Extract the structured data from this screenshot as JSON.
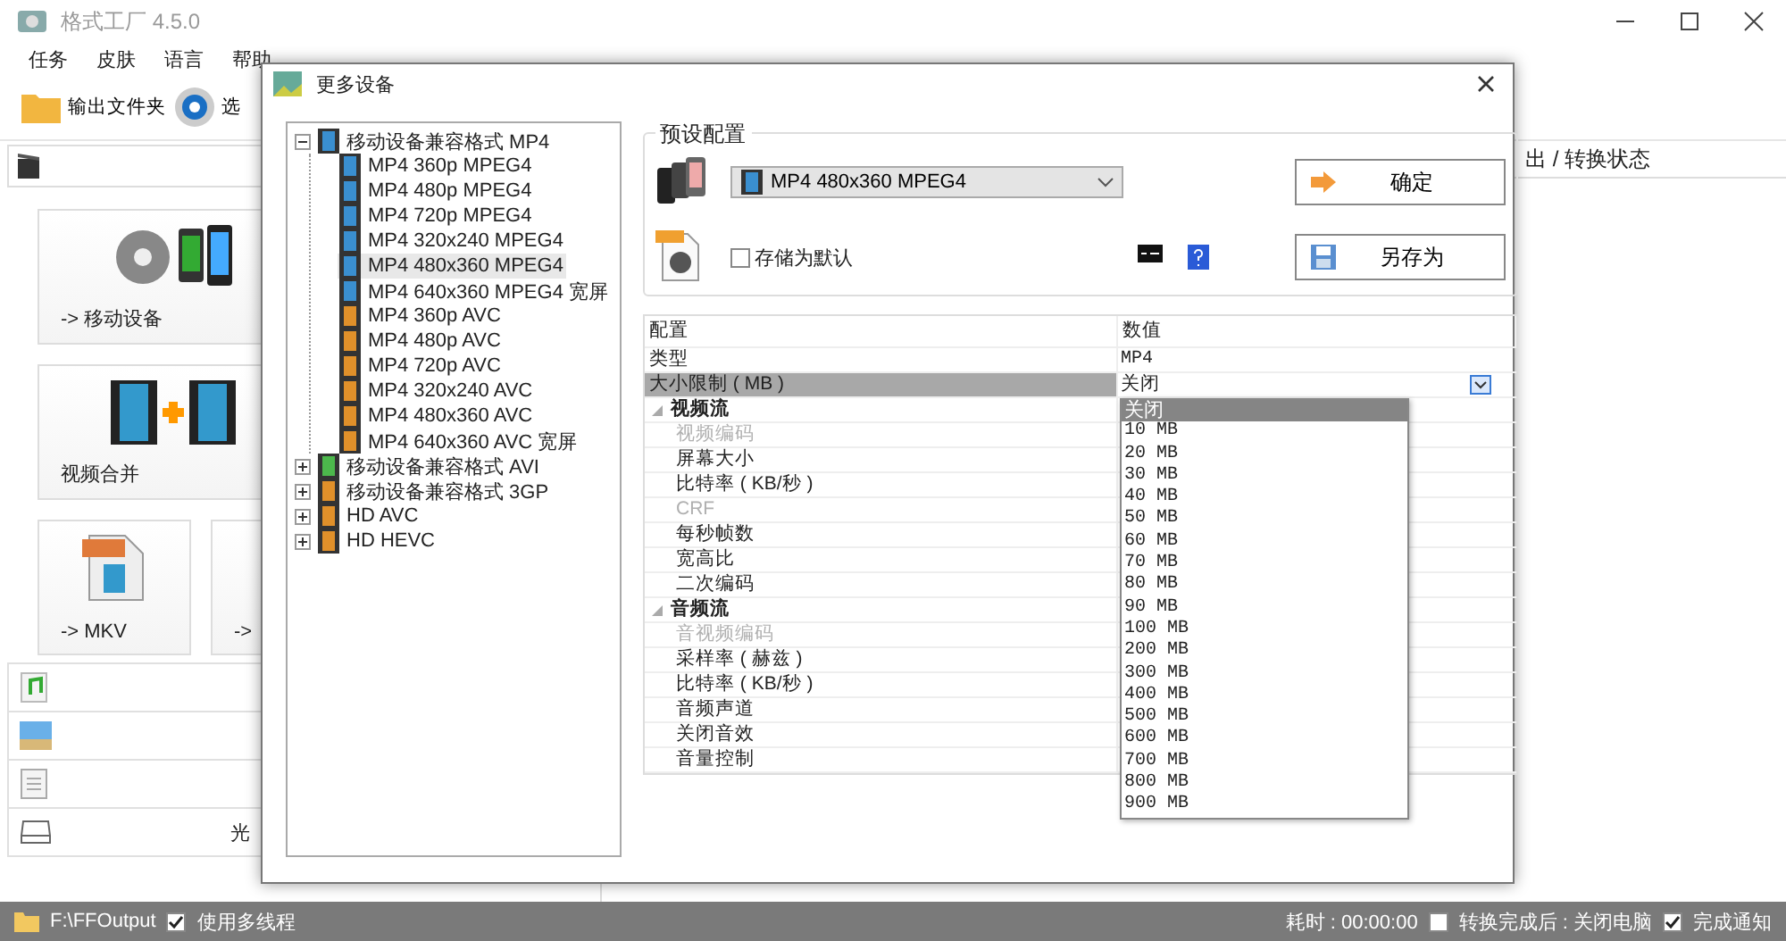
{
  "window": {
    "title": "格式工厂 4.5.0"
  },
  "menu": [
    "任务",
    "皮肤",
    "语言",
    "帮助"
  ],
  "toolbar": [
    {
      "label": "输出文件夹",
      "kind": "folder"
    },
    {
      "label": "选",
      "kind": "options"
    }
  ],
  "tiles": [
    {
      "label": "-> 移动设备",
      "kind": "devices"
    },
    {
      "label": "视频合并",
      "kind": "join"
    },
    {
      "label": "-> MKV",
      "kind": "mkv"
    },
    {
      "label": "->",
      "kind": "other"
    }
  ],
  "categories": [
    {
      "kind": "audio"
    },
    {
      "kind": "picture"
    },
    {
      "kind": "document"
    },
    {
      "kind": "disc",
      "label": "光"
    }
  ],
  "task_header": "出 / 转换状态",
  "dialog": {
    "title": "更多设备",
    "tree": [
      {
        "label": "移动设备兼容格式 MP4",
        "kind": "mp4",
        "expanded": true,
        "children": [
          {
            "label": "MP4 360p MPEG4",
            "kind": "mpeg4",
            "selected": false
          },
          {
            "label": "MP4 480p MPEG4",
            "kind": "mpeg4",
            "selected": false
          },
          {
            "label": "MP4 720p MPEG4",
            "kind": "mpeg4",
            "selected": false
          },
          {
            "label": "MP4 320x240 MPEG4",
            "kind": "mpeg4",
            "selected": false
          },
          {
            "label": "MP4 480x360 MPEG4",
            "kind": "mpeg4",
            "selected": true
          },
          {
            "label": "MP4 640x360 MPEG4 宽屏",
            "kind": "mpeg4",
            "selected": false
          },
          {
            "label": "MP4 360p AVC",
            "kind": "avc",
            "selected": false
          },
          {
            "label": "MP4 480p AVC",
            "kind": "avc",
            "selected": false
          },
          {
            "label": "MP4 720p AVC",
            "kind": "avc",
            "selected": false
          },
          {
            "label": "MP4 320x240 AVC",
            "kind": "avc",
            "selected": false
          },
          {
            "label": "MP4 480x360 AVC",
            "kind": "avc",
            "selected": false
          },
          {
            "label": "MP4 640x360 AVC 宽屏",
            "kind": "avc",
            "selected": false
          }
        ]
      },
      {
        "label": "移动设备兼容格式 AVI",
        "kind": "avi",
        "expanded": false
      },
      {
        "label": "移动设备兼容格式 3GP",
        "kind": "threegp",
        "expanded": false
      },
      {
        "label": "HD AVC",
        "kind": "hd",
        "expanded": false
      },
      {
        "label": "HD HEVC",
        "kind": "hd",
        "expanded": false
      }
    ],
    "preset": {
      "title": "预设配置",
      "value": "MP4 480x360 MPEG4",
      "ok": "确定",
      "save_default": {
        "label": "存储为默认",
        "checked": false
      },
      "save_as": "另存为"
    },
    "grid": {
      "columns": [
        "配置",
        "数值"
      ],
      "rows": [
        {
          "kind": "row",
          "label": "类型",
          "value": "MP4",
          "selected": false,
          "disabled": false
        },
        {
          "kind": "row",
          "label": "大小限制 ( MB )",
          "value": "关闭",
          "selected": true,
          "disabled": false
        },
        {
          "kind": "section",
          "label": "视频流",
          "expanded": true
        },
        {
          "kind": "row",
          "label": "视频编码",
          "selected": false,
          "disabled": true
        },
        {
          "kind": "row",
          "label": "屏幕大小",
          "selected": false,
          "disabled": false
        },
        {
          "kind": "row",
          "label": "比特率 ( KB/秒 )",
          "selected": false,
          "disabled": false
        },
        {
          "kind": "row",
          "label": "CRF",
          "selected": false,
          "disabled": true
        },
        {
          "kind": "row",
          "label": "每秒帧数",
          "selected": false,
          "disabled": false
        },
        {
          "kind": "row",
          "label": "宽高比",
          "selected": false,
          "disabled": false
        },
        {
          "kind": "row",
          "label": "二次编码",
          "selected": false,
          "disabled": false
        },
        {
          "kind": "section",
          "label": "音频流",
          "expanded": true
        },
        {
          "kind": "row",
          "label": "音视频编码",
          "selected": false,
          "disabled": true
        },
        {
          "kind": "row",
          "label": "采样率 ( 赫兹 )",
          "selected": false,
          "disabled": false
        },
        {
          "kind": "row",
          "label": "比特率 ( KB/秒 )",
          "selected": false,
          "disabled": false
        },
        {
          "kind": "row",
          "label": "音频声道",
          "selected": false,
          "disabled": false
        },
        {
          "kind": "row",
          "label": "关闭音效",
          "selected": false,
          "disabled": false
        },
        {
          "kind": "row",
          "label": "音量控制",
          "selected": false,
          "disabled": false
        }
      ],
      "options": [
        {
          "label": "关闭",
          "selected": true
        },
        {
          "label": "10 MB",
          "selected": false
        },
        {
          "label": "20 MB",
          "selected": false
        },
        {
          "label": "30 MB",
          "selected": false
        },
        {
          "label": "40 MB",
          "selected": false
        },
        {
          "label": "50 MB",
          "selected": false
        },
        {
          "label": "60 MB",
          "selected": false
        },
        {
          "label": "70 MB",
          "selected": false
        },
        {
          "label": "80 MB",
          "selected": false
        },
        {
          "label": "90 MB",
          "selected": false
        },
        {
          "label": "100 MB",
          "selected": false
        },
        {
          "label": "200 MB",
          "selected": false
        },
        {
          "label": "300 MB",
          "selected": false
        },
        {
          "label": "400 MB",
          "selected": false
        },
        {
          "label": "500 MB",
          "selected": false
        },
        {
          "label": "600 MB",
          "selected": false
        },
        {
          "label": "700 MB",
          "selected": false
        },
        {
          "label": "800 MB",
          "selected": false
        },
        {
          "label": "900 MB",
          "selected": false
        }
      ]
    }
  },
  "status_bar": {
    "output_folder": "F:\\FFOutput",
    "multithread": {
      "label": "使用多线程",
      "checked": true
    },
    "elapsed": "耗时 : 00:00:00",
    "shutdown": {
      "label": "转换完成后 : 关闭电脑",
      "checked": false
    },
    "notify": {
      "label": "完成通知",
      "checked": true
    }
  }
}
